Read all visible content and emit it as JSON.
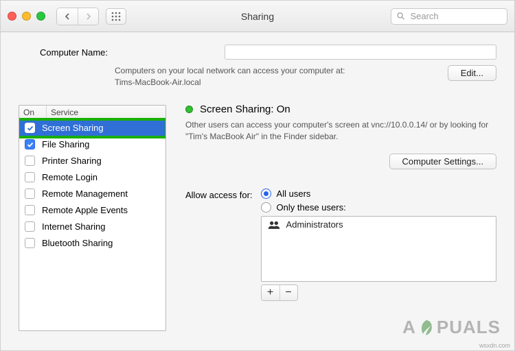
{
  "window": {
    "title": "Sharing",
    "search_placeholder": "Search"
  },
  "computer_name": {
    "label": "Computer Name:",
    "value": "",
    "subtext_line1": "Computers on your local network can access your computer at:",
    "subtext_line2": "Tims-MacBook-Air.local",
    "edit_label": "Edit..."
  },
  "service_table": {
    "col_on": "On",
    "col_service": "Service",
    "rows": [
      {
        "label": "Screen Sharing",
        "checked": true,
        "selected": true
      },
      {
        "label": "File Sharing",
        "checked": true,
        "selected": false
      },
      {
        "label": "Printer Sharing",
        "checked": false,
        "selected": false
      },
      {
        "label": "Remote Login",
        "checked": false,
        "selected": false
      },
      {
        "label": "Remote Management",
        "checked": false,
        "selected": false
      },
      {
        "label": "Remote Apple Events",
        "checked": false,
        "selected": false
      },
      {
        "label": "Internet Sharing",
        "checked": false,
        "selected": false
      },
      {
        "label": "Bluetooth Sharing",
        "checked": false,
        "selected": false
      }
    ]
  },
  "detail": {
    "status_title": "Screen Sharing: On",
    "status_desc": "Other users can access your computer's screen at vnc://10.0.0.14/ or by looking for \"Tim's MacBook Air\" in the Finder sidebar.",
    "computer_settings_label": "Computer Settings...",
    "allow_label": "Allow access for:",
    "radio_all": "All users",
    "radio_only": "Only these users:",
    "radio_selected": "all",
    "user_list": [
      {
        "label": "Administrators"
      }
    ],
    "add_label": "+",
    "remove_label": "−"
  },
  "watermark": {
    "text_left": "A",
    "text_right": "PUALS",
    "credit": "wsxdn.com"
  }
}
